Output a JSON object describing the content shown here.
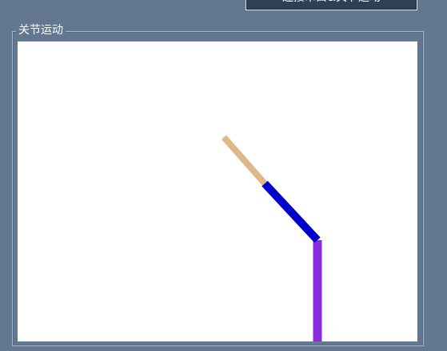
{
  "toolbar": {
    "motion_button_label": "连接串口&关节运动"
  },
  "joint_panel": {
    "title": "关节运动",
    "links": [
      {
        "name": "link-base",
        "color": "#8a2be2"
      },
      {
        "name": "link-middle",
        "color": "#0000cd"
      },
      {
        "name": "link-end",
        "color": "#deb887"
      }
    ]
  }
}
